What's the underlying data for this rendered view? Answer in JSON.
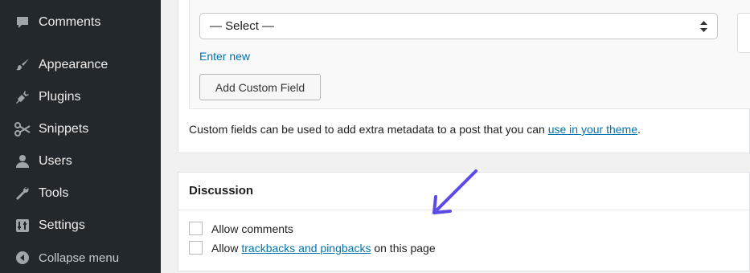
{
  "sidebar": {
    "items": [
      {
        "label": "Comments",
        "icon": "comment-icon"
      },
      {
        "label": "Appearance",
        "icon": "paintbrush-icon"
      },
      {
        "label": "Plugins",
        "icon": "plugin-icon"
      },
      {
        "label": "Snippets",
        "icon": "scissors-icon"
      },
      {
        "label": "Users",
        "icon": "user-icon"
      },
      {
        "label": "Tools",
        "icon": "wrench-icon"
      },
      {
        "label": "Settings",
        "icon": "settings-icon"
      }
    ],
    "collapse_label": "Collapse menu"
  },
  "custom_fields": {
    "select_value": "— Select —",
    "enter_new_label": "Enter new",
    "add_button_label": "Add Custom Field",
    "note_prefix": "Custom fields can be used to add extra metadata to a post that you can ",
    "note_link": "use in your theme",
    "note_suffix": "."
  },
  "discussion": {
    "title": "Discussion",
    "allow_comments_label": "Allow comments",
    "allow_trackbacks_prefix": "Allow ",
    "allow_trackbacks_link": "trackbacks and pingbacks",
    "allow_trackbacks_suffix": " on this page"
  },
  "colors": {
    "sidebar_bg": "#23282d",
    "link": "#0073aa",
    "annotation_arrow": "#5b4ae8"
  }
}
